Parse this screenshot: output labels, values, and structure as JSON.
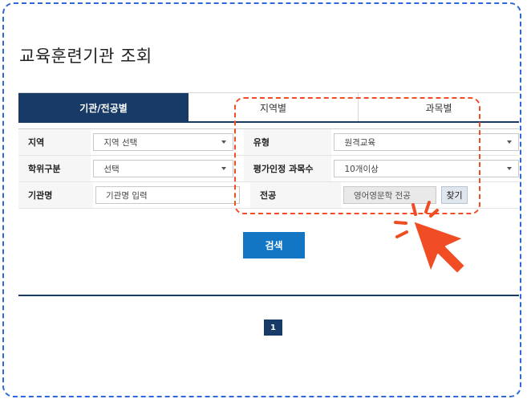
{
  "page": {
    "title": "교육훈련기관 조회"
  },
  "tabs": [
    {
      "label": "기관/전공별",
      "active": true
    },
    {
      "label": "지역별",
      "active": false
    },
    {
      "label": "과목별",
      "active": false
    }
  ],
  "form": {
    "region": {
      "label": "지역",
      "value": "지역 선택"
    },
    "type": {
      "label": "유형",
      "value": "원격교육"
    },
    "degree": {
      "label": "학위구분",
      "value": "선택"
    },
    "credit_courses": {
      "label": "평가인정 과목수",
      "value": "10개이상"
    },
    "institution": {
      "label": "기관명",
      "placeholder": "기관명 입력"
    },
    "major": {
      "label": "전공",
      "value": "영어영문학 전공"
    },
    "find_button": "찾기"
  },
  "search_button": "검색",
  "pagination": {
    "current": "1"
  },
  "colors": {
    "navy": "#173a66",
    "blue_button": "#1376c4",
    "highlight": "#f04d25",
    "frame": "#2f67d8"
  }
}
